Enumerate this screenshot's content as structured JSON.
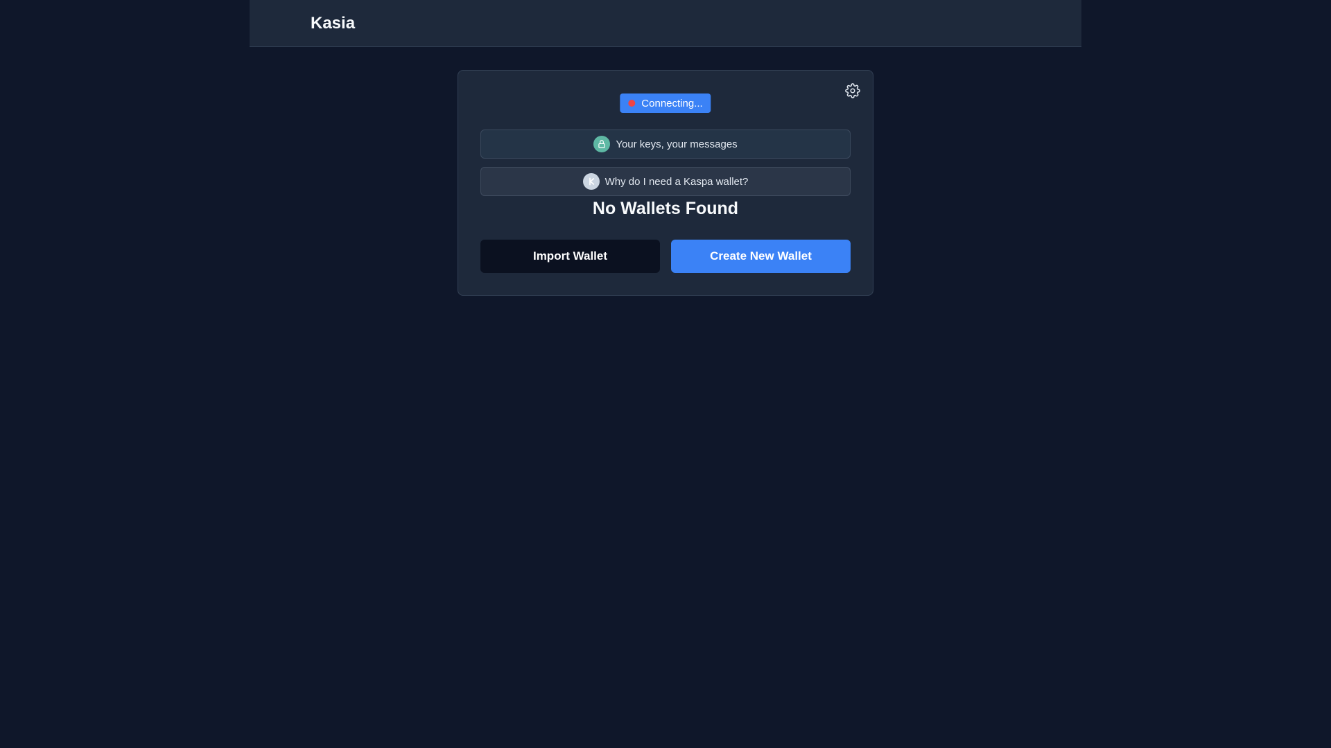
{
  "header": {
    "title": "Kasia"
  },
  "status": {
    "label": "Connecting...",
    "dot_color": "#ef4444"
  },
  "info": {
    "keys_label": "Your keys, your messages",
    "why_label": "Why do I need a Kaspa wallet?"
  },
  "main": {
    "heading": "No Wallets Found"
  },
  "actions": {
    "import_label": "Import Wallet",
    "create_label": "Create New Wallet"
  },
  "icons": {
    "settings": "gear-icon",
    "keys": "lock-icon",
    "why": "kaspa-logo-icon"
  },
  "colors": {
    "background": "#0f172a",
    "panel": "#1e293b",
    "accent": "#3b82f6",
    "lock_badge": "#5eb8a4"
  }
}
